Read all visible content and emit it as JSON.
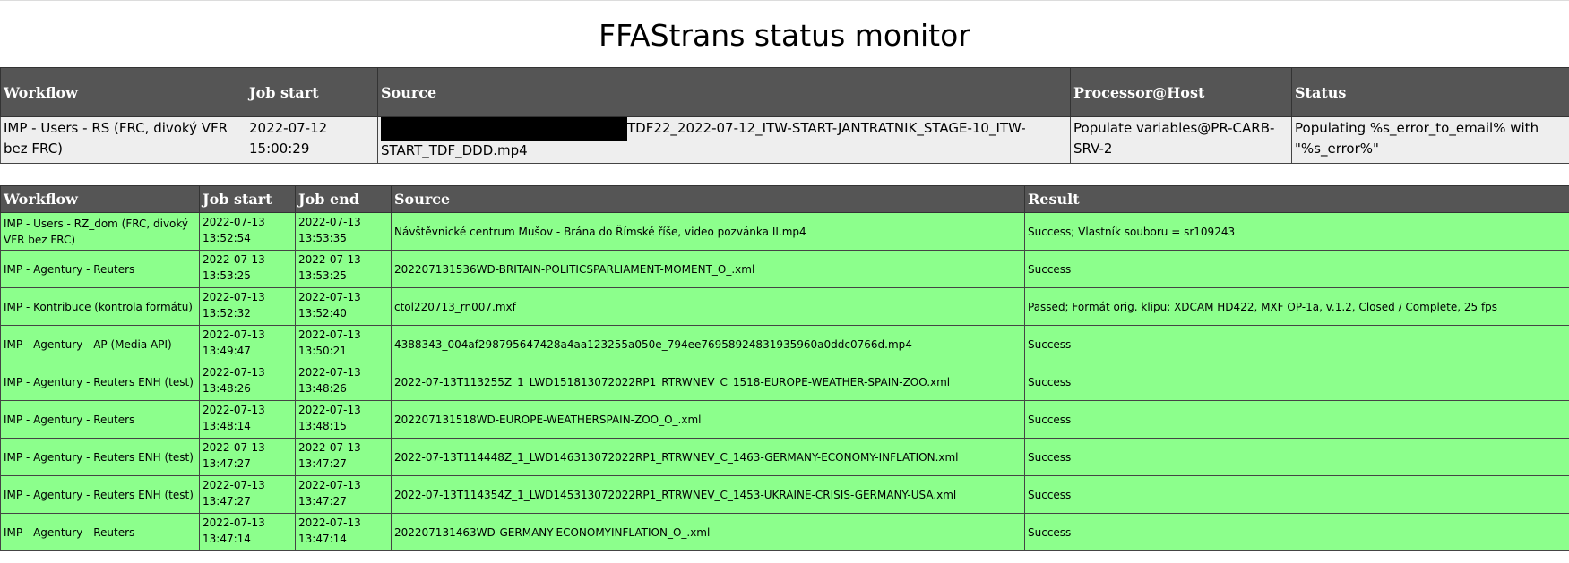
{
  "page": {
    "title": "FFAStrans status monitor"
  },
  "running": {
    "headers": [
      "Workflow",
      "Job start",
      "Source",
      "Processor@Host",
      "Status"
    ],
    "rows": [
      {
        "workflow": "IMP - Users - RS (FRC, divoký VFR bez FRC)",
        "job_start": "2022-07-12 15:00:29",
        "source": "TDF22_2022-07-12_ITW-START-JANTRATNIK_STAGE-10_ITW-START_TDF_DDD.mp4",
        "processor": "Populate variables@PR-CARB-SRV-2",
        "status": "Populating %s_error_to_email% with \"%s_error%\""
      }
    ]
  },
  "history": {
    "headers": [
      "Workflow",
      "Job start",
      "Job end",
      "Source",
      "Result"
    ],
    "rows": [
      {
        "workflow": "IMP - Users - RZ_dom (FRC, divoký VFR bez FRC)",
        "start": "2022-07-13 13:52:54",
        "end": "2022-07-13 13:53:35",
        "source": "Návštěvnické centrum Mušov - Brána do Římské říše, video pozvánka II.mp4",
        "result": "Success; Vlastník souboru = sr109243"
      },
      {
        "workflow": "IMP - Agentury - Reuters",
        "start": "2022-07-13 13:53:25",
        "end": "2022-07-13 13:53:25",
        "source": "202207131536WD-BRITAIN-POLITICSPARLIAMENT-MOMENT_O_.xml",
        "result": "Success"
      },
      {
        "workflow": "IMP - Kontribuce (kontrola formátu)",
        "start": "2022-07-13 13:52:32",
        "end": "2022-07-13 13:52:40",
        "source": "ctol220713_rn007.mxf",
        "result": "Passed; Formát orig. klipu: XDCAM HD422, MXF OP-1a, v.1.2, Closed / Complete, 25 fps"
      },
      {
        "workflow": "IMP - Agentury - AP (Media API)",
        "start": "2022-07-13 13:49:47",
        "end": "2022-07-13 13:50:21",
        "source": "4388343_004af298795647428a4aa123255a050e_794ee76958924831935960a0ddc0766d.mp4",
        "result": "Success"
      },
      {
        "workflow": "IMP - Agentury - Reuters ENH (test)",
        "start": "2022-07-13 13:48:26",
        "end": "2022-07-13 13:48:26",
        "source": "2022-07-13T113255Z_1_LWD151813072022RP1_RTRWNEV_C_1518-EUROPE-WEATHER-SPAIN-ZOO.xml",
        "result": "Success"
      },
      {
        "workflow": "IMP - Agentury - Reuters",
        "start": "2022-07-13 13:48:14",
        "end": "2022-07-13 13:48:15",
        "source": "202207131518WD-EUROPE-WEATHERSPAIN-ZOO_O_.xml",
        "result": "Success"
      },
      {
        "workflow": "IMP - Agentury - Reuters ENH (test)",
        "start": "2022-07-13 13:47:27",
        "end": "2022-07-13 13:47:27",
        "source": "2022-07-13T114448Z_1_LWD146313072022RP1_RTRWNEV_C_1463-GERMANY-ECONOMY-INFLATION.xml",
        "result": "Success"
      },
      {
        "workflow": "IMP - Agentury - Reuters ENH (test)",
        "start": "2022-07-13 13:47:27",
        "end": "2022-07-13 13:47:27",
        "source": "2022-07-13T114354Z_1_LWD145313072022RP1_RTRWNEV_C_1453-UKRAINE-CRISIS-GERMANY-USA.xml",
        "result": "Success"
      },
      {
        "workflow": "IMP - Agentury - Reuters",
        "start": "2022-07-13 13:47:14",
        "end": "2022-07-13 13:47:14",
        "source": "202207131463WD-GERMANY-ECONOMYINFLATION_O_.xml",
        "result": "Success"
      }
    ]
  },
  "colors": {
    "header_bg": "#555555",
    "running_row_bg": "#eeeeee",
    "success_row_bg": "#8cff8c"
  }
}
